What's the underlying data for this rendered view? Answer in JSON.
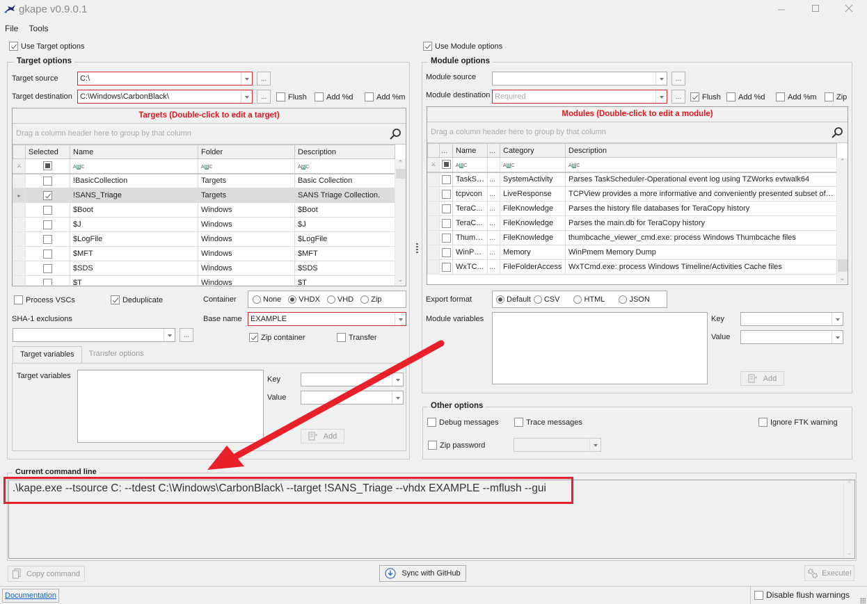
{
  "window": {
    "title": "gkape v0.9.0.1",
    "icon": "kape-app-icon",
    "minimize_icon": "minimize-icon",
    "maximize_icon": "maximize-icon",
    "close_icon": "close-icon"
  },
  "menu": {
    "items": [
      {
        "label": "File"
      },
      {
        "label": "Tools"
      }
    ]
  },
  "target": {
    "use_label": "Use Target options",
    "use_checked": true,
    "group_title": "Target options",
    "source_label": "Target source",
    "source_value": "C:\\",
    "destination_label": "Target destination",
    "destination_value": "C:\\Windows\\CarbonBlack\\",
    "browse_label": "...",
    "flush_label": "Flush",
    "flush_checked": false,
    "add_d_label": "Add %d",
    "add_d_checked": false,
    "add_m_label": "Add %m",
    "add_m_checked": false,
    "grid": {
      "caption": "Targets (Double-click to edit a target)",
      "group_hint": "Drag a column header here to group by that column",
      "columns": [
        "Selected",
        "Name",
        "Folder",
        "Description"
      ],
      "rows": [
        {
          "selected": false,
          "name": "!BasicCollection",
          "folder": "Targets",
          "description": "Basic Collection"
        },
        {
          "selected": true,
          "name": "!SANS_Triage",
          "folder": "Targets",
          "description": "SANS Triage Collection.",
          "current": true
        },
        {
          "selected": false,
          "name": "$Boot",
          "folder": "Windows",
          "description": "$Boot"
        },
        {
          "selected": false,
          "name": "$J",
          "folder": "Windows",
          "description": "$J"
        },
        {
          "selected": false,
          "name": "$LogFile",
          "folder": "Windows",
          "description": "$LogFile"
        },
        {
          "selected": false,
          "name": "$MFT",
          "folder": "Windows",
          "description": "$MFT"
        },
        {
          "selected": false,
          "name": "$SDS",
          "folder": "Windows",
          "description": "$SDS"
        },
        {
          "selected": false,
          "name": "$T",
          "folder": "Windows",
          "description": "$T"
        }
      ]
    },
    "process_vscs_label": "Process VSCs",
    "process_vscs_checked": false,
    "deduplicate_label": "Deduplicate",
    "deduplicate_checked": true,
    "container_label": "Container",
    "container_options": [
      "None",
      "VHDX",
      "VHD",
      "Zip"
    ],
    "container_selected": "VHDX",
    "sha1_label": "SHA-1 exclusions",
    "sha1_value": "",
    "base_name_label": "Base name",
    "base_name_value": "EXAMPLE",
    "zip_container_label": "Zip container",
    "zip_container_checked": true,
    "transfer_label": "Transfer",
    "transfer_checked": false,
    "tabs": [
      {
        "label": "Target variables",
        "active": true
      },
      {
        "label": "Transfer options",
        "active": false
      }
    ],
    "variables_label": "Target variables",
    "key_label": "Key",
    "value_label": "Value",
    "add_label": "Add"
  },
  "module": {
    "use_label": "Use Module options",
    "use_checked": true,
    "group_title": "Module options",
    "source_label": "Module source",
    "source_value": "",
    "destination_label": "Module destination",
    "destination_placeholder": "Required",
    "browse_label": "...",
    "flush_label": "Flush",
    "flush_checked": true,
    "add_d_label": "Add %d",
    "add_d_checked": false,
    "add_m_label": "Add %m",
    "add_m_checked": false,
    "zip_label": "Zip",
    "zip_checked": false,
    "grid": {
      "caption": "Modules (Double-click to edit a module)",
      "group_hint": "Drag a column header here to group by that column",
      "columns": [
        "...",
        "Name",
        "...",
        "Category",
        "Description"
      ],
      "rows": [
        {
          "selected": false,
          "name": "TaskSc...",
          "extra": "...",
          "category": "SystemActivity",
          "description": "Parses TaskScheduler-Operational event log using TZWorks evtwalk64"
        },
        {
          "selected": false,
          "name": "tcpvcon",
          "extra": "...",
          "category": "LiveResponse",
          "description": "TCPView provides a more informative and conveniently presented subset of t..."
        },
        {
          "selected": false,
          "name": "TeraC...",
          "extra": "...",
          "category": "FileKnowledge",
          "description": "Parses the history file databases for TeraCopy history"
        },
        {
          "selected": false,
          "name": "TeraC...",
          "extra": "...",
          "category": "FileKnowledge",
          "description": "Parses the main.db for TeraCopy history"
        },
        {
          "selected": false,
          "name": "Thumb...",
          "extra": "...",
          "category": "FileKnowledge",
          "description": "thumbcache_viewer_cmd.exe: process Windows Thumbcache files"
        },
        {
          "selected": false,
          "name": "WinPm...",
          "extra": "...",
          "category": "Memory",
          "description": "WinPmem Memory Dump"
        },
        {
          "selected": false,
          "name": "WxTC...",
          "extra": "...",
          "category": "FileFolderAccess",
          "description": "WxTCmd.exe: process Windows Timeline/Activities Cache files"
        }
      ]
    },
    "export_label": "Export format",
    "export_options": [
      "Default",
      "CSV",
      "HTML",
      "JSON"
    ],
    "export_selected": "Default",
    "variables_label": "Module variables",
    "key_label": "Key",
    "value_label": "Value",
    "add_label": "Add"
  },
  "other": {
    "group_title": "Other options",
    "debug_label": "Debug messages",
    "debug_checked": false,
    "trace_label": "Trace messages",
    "trace_checked": false,
    "ignore_ftk_label": "Ignore FTK warning",
    "ignore_ftk_checked": false,
    "zip_password_label": "Zip password",
    "zip_password_checked": false
  },
  "command": {
    "group_title": "Current command line",
    "text": ".\\kape.exe --tsource C: --tdest C:\\Windows\\CarbonBlack\\ --target !SANS_Triage --vhdx EXAMPLE --mflush --gui",
    "highlight_color": "#e8202a"
  },
  "actions": {
    "copy_label": "Copy command",
    "sync_label": "Sync with GitHub",
    "execute_label": "Execute!"
  },
  "status": {
    "documentation_label": "Documentation",
    "disable_flush_label": "Disable flush warnings",
    "disable_flush_checked": false
  },
  "annotation": {
    "arrow_color": "#e8202a"
  }
}
